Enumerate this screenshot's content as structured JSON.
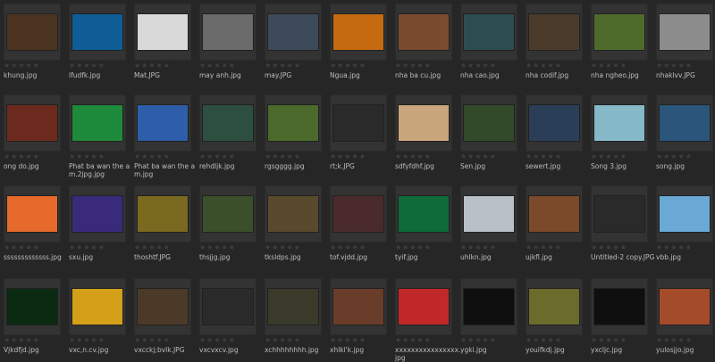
{
  "gallery": {
    "rating_text": "★★★★★",
    "items": [
      {
        "name": "khung.jpg",
        "thumb_color": "#4a3420",
        "icon": "image-icon"
      },
      {
        "name": "lfudfk.jpg",
        "thumb_color": "#0e5d96",
        "icon": "image-icon"
      },
      {
        "name": "Mat.JPG",
        "thumb_color": "#d9d9d9",
        "icon": "image-icon"
      },
      {
        "name": "may anh.jpg",
        "thumb_color": "#6b6b6b",
        "icon": "image-icon"
      },
      {
        "name": "may.JPG",
        "thumb_color": "#3d4a5a",
        "icon": "image-icon"
      },
      {
        "name": "Ngua.jpg",
        "thumb_color": "#c66a12",
        "icon": "image-icon"
      },
      {
        "name": "nha ba cu.jpg",
        "thumb_color": "#7a4b2e",
        "icon": "image-icon"
      },
      {
        "name": "nha cao.jpg",
        "thumb_color": "#2c4d4f",
        "icon": "image-icon"
      },
      {
        "name": "nha codif.jpg",
        "thumb_color": "#4a3b2a",
        "icon": "image-icon"
      },
      {
        "name": "nha ngheo.jpg",
        "thumb_color": "#4e6b2b",
        "icon": "image-icon"
      },
      {
        "name": "nhaklvv.JPG",
        "thumb_color": "#8d8d8d",
        "icon": "image-icon"
      },
      {
        "name": "ong do.jpg",
        "thumb_color": "#6b2a1d",
        "icon": "image-icon"
      },
      {
        "name": "Phat ba wan the am.2jpg.jpg",
        "thumb_color": "#1e8a3c",
        "icon": "image-icon"
      },
      {
        "name": "Phat ba wan the am.jpg",
        "thumb_color": "#2e5ea9",
        "icon": "image-icon"
      },
      {
        "name": "rehdljk.jpg",
        "thumb_color": "#2c4f3f",
        "icon": "image-icon"
      },
      {
        "name": "rgsgggg.jpg",
        "thumb_color": "#4b6a2c",
        "icon": "image-icon"
      },
      {
        "name": "rt;k.JPG",
        "thumb_color": "#2a2a2a",
        "icon": "image-icon"
      },
      {
        "name": "sdfyfdhf.jpg",
        "thumb_color": "#c9a57b",
        "icon": "image-icon"
      },
      {
        "name": "Sen.jpg",
        "thumb_color": "#324a2a",
        "icon": "image-icon"
      },
      {
        "name": "sewert.jpg",
        "thumb_color": "#2b3e57",
        "icon": "image-icon"
      },
      {
        "name": "Song 3.jpg",
        "thumb_color": "#86b9c7",
        "icon": "image-icon"
      },
      {
        "name": "song.jpg",
        "thumb_color": "#2c557c",
        "icon": "image-icon"
      },
      {
        "name": "sssssssssssss.jpg",
        "thumb_color": "#e56a2c",
        "icon": "image-icon"
      },
      {
        "name": "sxu.jpg",
        "thumb_color": "#3a2a7b",
        "icon": "image-icon"
      },
      {
        "name": "thoshtf.JPG",
        "thumb_color": "#7a6a1f",
        "icon": "image-icon"
      },
      {
        "name": "thsjjg.jpg",
        "thumb_color": "#3b4f2a",
        "icon": "image-icon"
      },
      {
        "name": "tksldps.jpg",
        "thumb_color": "#5a4a2d",
        "icon": "image-icon"
      },
      {
        "name": "tof.vjdd.jpg",
        "thumb_color": "#4a2a2a",
        "icon": "image-icon"
      },
      {
        "name": "tyif.jpg",
        "thumb_color": "#0f6b3a",
        "icon": "image-icon"
      },
      {
        "name": "uhlkn.jpg",
        "thumb_color": "#b8c0c8",
        "icon": "image-icon"
      },
      {
        "name": "ujkfl.jpg",
        "thumb_color": "#7a4a2a",
        "icon": "image-icon"
      },
      {
        "name": "Untitled-2 copy.JPG",
        "thumb_color": "#2a2a2a",
        "icon": "image-icon"
      },
      {
        "name": "vbb.jpg",
        "thumb_color": "#6aa8d6",
        "icon": "image-icon"
      },
      {
        "name": "Vjkdfjd.jpg",
        "thumb_color": "#0b2a12",
        "icon": "image-icon"
      },
      {
        "name": "vxc,n.cv.jpg",
        "thumb_color": "#d4a01a",
        "icon": "image-icon"
      },
      {
        "name": "vxcckj;bvlk.JPG",
        "thumb_color": "#4c3a28",
        "icon": "image-icon"
      },
      {
        "name": "vxcvxcv.jpg",
        "thumb_color": "#2a2a2a",
        "icon": "image-icon"
      },
      {
        "name": "xchhhhhhhh.jpg",
        "thumb_color": "#3a3a2a",
        "icon": "image-icon"
      },
      {
        "name": "xhlkl'k.jpg",
        "thumb_color": "#6a3c2a",
        "icon": "image-icon"
      },
      {
        "name": "xxxxxxxxxxxxxxxx.jpg",
        "thumb_color": "#c0282a",
        "icon": "image-icon"
      },
      {
        "name": "ygki.jpg",
        "thumb_color": "#0f0f0f",
        "icon": "image-icon"
      },
      {
        "name": "youifkdj.jpg",
        "thumb_color": "#6b6b2b",
        "icon": "image-icon"
      },
      {
        "name": "yxcljc.jpg",
        "thumb_color": "#0f0f0f",
        "icon": "image-icon"
      },
      {
        "name": "yulosjjo.jpg",
        "thumb_color": "#a44b2a",
        "icon": "image-icon"
      }
    ]
  }
}
